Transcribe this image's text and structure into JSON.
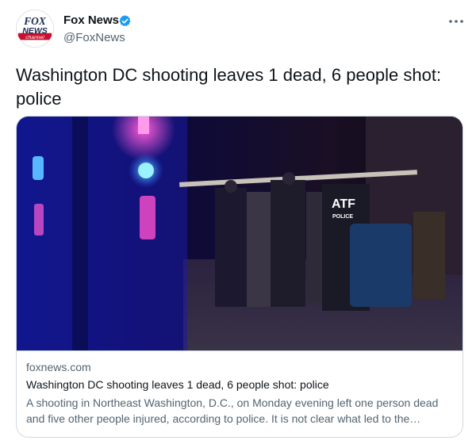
{
  "account": {
    "name": "Fox News",
    "handle": "@FoxNews",
    "logo_text": [
      "FOX",
      "NEWS",
      "channel"
    ]
  },
  "icons": {
    "verified": "verified-badge-icon",
    "more": "more-options-icon"
  },
  "tweet": {
    "text": "Washington DC shooting leaves 1 dead, 6 people shot: police"
  },
  "card": {
    "image_badge": "ATF",
    "image_badge_sub": "POLICE",
    "domain": "foxnews.com",
    "title": "Washington DC shooting leaves 1 dead, 6 people shot: police",
    "description": "A shooting in Northeast Washington, D.C., on Monday evening left one person dead and five other people injured, according to police. It is not clear what led to the shooting."
  },
  "colors": {
    "verified": "#1d9bf0",
    "text_primary": "#0f1419",
    "text_secondary": "#536471",
    "border": "#cfd9de",
    "fox_red": "#c8102e",
    "fox_navy": "#1b2a4e"
  }
}
